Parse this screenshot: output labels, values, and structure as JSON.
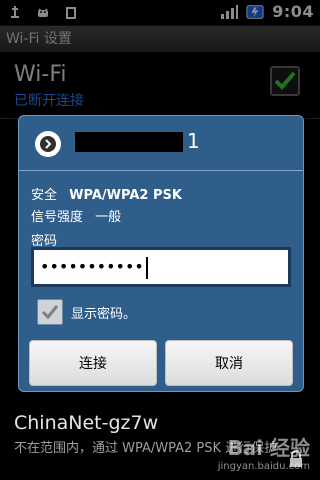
{
  "status_bar": {
    "left_icons": [
      "usb-icon",
      "android-icon",
      "phone-icon"
    ],
    "time": "9:04",
    "right_icons": [
      "signal-icon",
      "battery-charging-icon"
    ]
  },
  "settings": {
    "title": "Wi-Fi 设置",
    "wifi_toggle": {
      "title": "Wi-Fi",
      "status": "已断开连接",
      "checked": true
    },
    "bottom_network": {
      "name": "ChinaNet-gz7w",
      "status": "不在范围内，通过 WPA/WPA2 PSK 进行保护"
    }
  },
  "dialog": {
    "ssid_suffix": "1",
    "security_label": "安全",
    "security_value": "WPA/WPA2 PSK",
    "signal_label": "信号强度",
    "signal_value": "一般",
    "password_label": "密码",
    "password_value": "•••••••••••",
    "show_password_label": "显示密码。",
    "show_password_checked": true,
    "buttons": {
      "connect": "连接",
      "cancel": "取消"
    }
  },
  "watermark": {
    "brand": "Bai 经验",
    "site": "jingyan.baidu.com"
  },
  "colors": {
    "accent_blue": "#2f86ff",
    "dialog_bg": "#2f5e8a"
  }
}
